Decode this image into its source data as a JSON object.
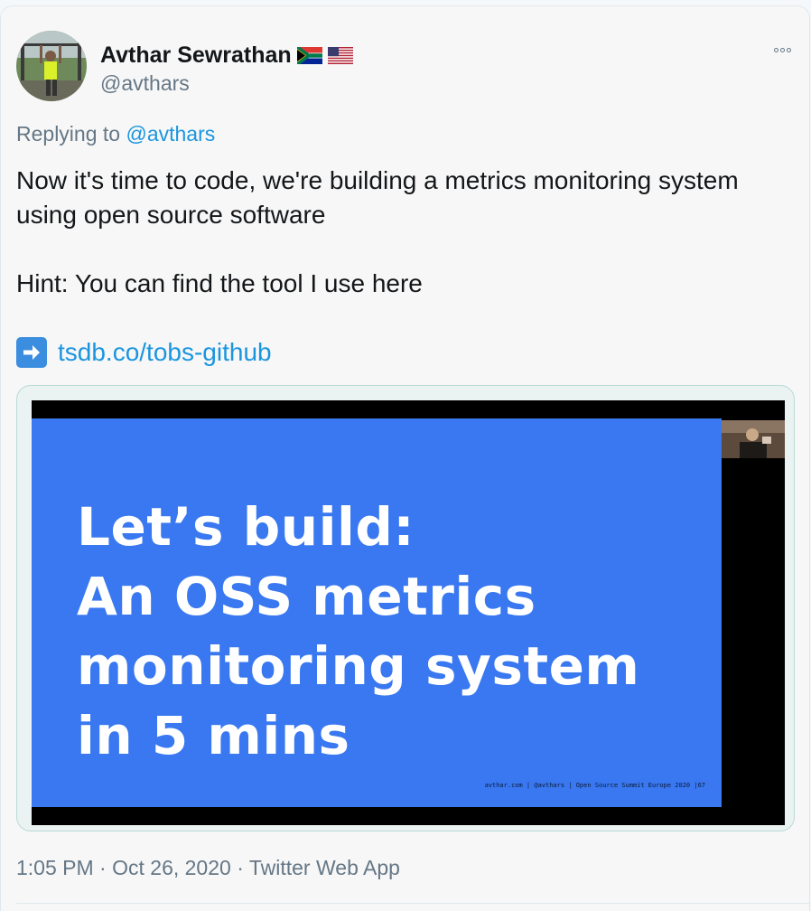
{
  "tweet": {
    "author_name": "Avthar Sewrathan",
    "author_handle": "@avthars",
    "flags": [
      "south-africa-flag-icon",
      "usa-flag-icon"
    ],
    "reply_prefix": "Replying to",
    "reply_to": "@avthars",
    "text_line1": "Now it's time to code, we're building a metrics monitoring system using open source software",
    "text_line2": "Hint: You can find the tool I use here",
    "link_icon": "right-arrow-icon",
    "link_text": "tsdb.co/tobs-github",
    "media": {
      "slide_line1": "Let’s build:",
      "slide_line2": "An OSS metrics",
      "slide_line3": "monitoring system",
      "slide_line4": "in 5 mins",
      "slide_footer": "avthar.com | @avthars | Open Source Summit Europe 2020 |67"
    },
    "time": "1:05 PM",
    "date": "Oct 26, 2020",
    "source": "Twitter Web App",
    "separator": "·"
  },
  "colors": {
    "link": "#1b95e0",
    "slide_bg": "#3978f0",
    "muted": "#657786"
  }
}
